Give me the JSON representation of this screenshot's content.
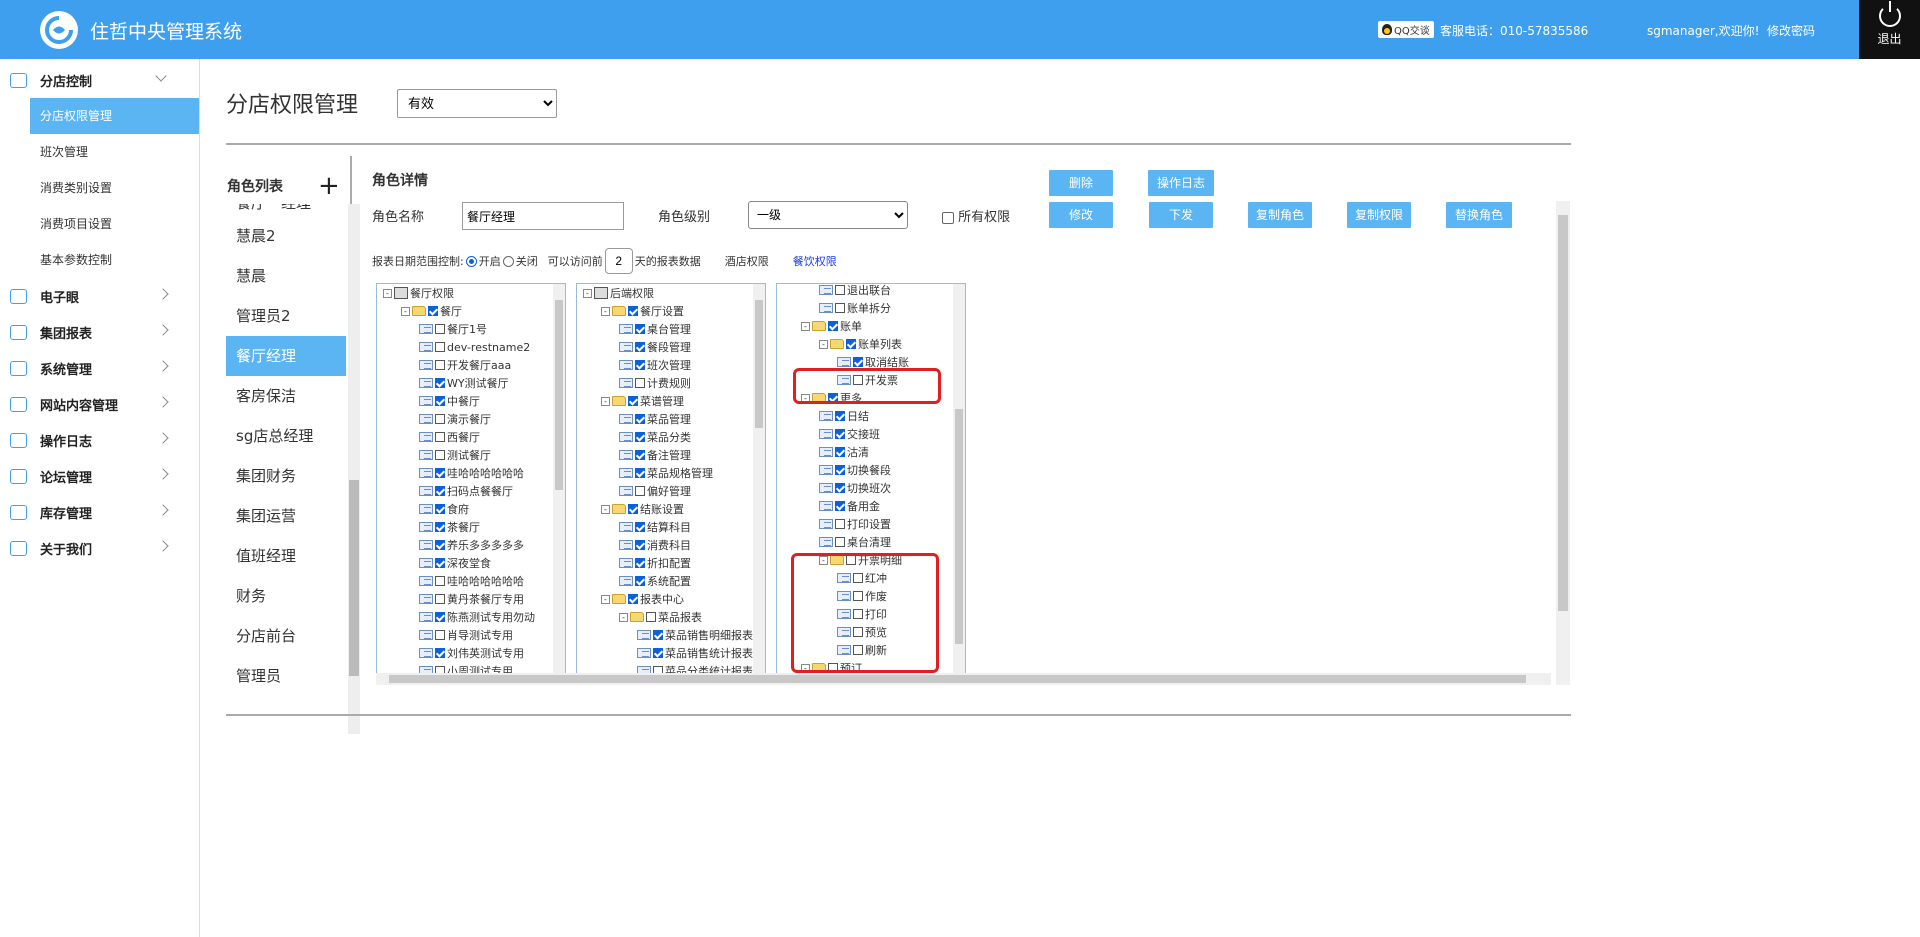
{
  "header": {
    "title": "住哲中央管理系统",
    "qq_label": "QQ交谈",
    "hotline": "客服电话：010-57835586",
    "welcome": "sgmanager,欢迎你!",
    "change_password": "修改密码",
    "logout": "退出"
  },
  "sidebar": {
    "groups": [
      {
        "label": "分店控制",
        "icon": "store-icon"
      },
      {
        "label": "电子眼",
        "icon": "camera-icon"
      },
      {
        "label": "集团报表",
        "icon": "chart-icon"
      },
      {
        "label": "系统管理",
        "icon": "settings-icon"
      },
      {
        "label": "网站内容管理",
        "icon": "grid-icon"
      },
      {
        "label": "操作日志",
        "icon": "log-icon"
      },
      {
        "label": "论坛管理",
        "icon": "atom-icon"
      },
      {
        "label": "库存管理",
        "icon": "inventory-icon"
      },
      {
        "label": "关于我们",
        "icon": "user-icon"
      }
    ],
    "sub_items": [
      "分店权限管理",
      "班次管理",
      "消费类别设置",
      "消费项目设置",
      "基本参数控制"
    ]
  },
  "main": {
    "page_title": "分店权限管理",
    "status_value": "有效",
    "role_list_header": "角色列表",
    "role_partial": "餐厅一经理",
    "roles": [
      "慧晨2",
      "慧晨",
      "管理员2",
      "餐厅经理",
      "客房保洁",
      "sg店总经理",
      "集团财务",
      "集团运营",
      "值班经理",
      "财务",
      "分店前台",
      "管理员"
    ],
    "detail_header": "角色详情",
    "buttons": {
      "delete": "删除",
      "op_log": "操作日志",
      "modify": "修改",
      "dispatch": "下发",
      "copy_role": "复制角色",
      "copy_perm": "复制权限",
      "replace_role": "替换角色"
    },
    "role_name_label": "角色名称",
    "role_name_value": "餐厅经理",
    "role_level_label": "角色级别",
    "role_level_value": "一级",
    "all_perm_label": "所有权限",
    "report_ctrl_label": "报表日期范围控制:",
    "open_label": "开启",
    "close_label": "关闭",
    "access_prefix": "可以访问前",
    "access_days": "2",
    "access_suffix": "天的报表数据",
    "hotel_perm": "酒店权限",
    "dining_perm": "餐饮权限"
  },
  "tree1": [
    {
      "t": "餐厅权限",
      "lvl": 0,
      "kind": "root",
      "cb": null
    },
    {
      "t": "餐厅",
      "lvl": 1,
      "kind": "folder",
      "cb": true
    },
    {
      "t": "餐厅1号",
      "lvl": 2,
      "kind": "leaf",
      "cb": false
    },
    {
      "t": "dev-restname2",
      "lvl": 2,
      "kind": "leaf",
      "cb": false
    },
    {
      "t": "开发餐厅aaa",
      "lvl": 2,
      "kind": "leaf",
      "cb": false
    },
    {
      "t": "WY测试餐厅",
      "lvl": 2,
      "kind": "leaf",
      "cb": true
    },
    {
      "t": "中餐厅",
      "lvl": 2,
      "kind": "leaf",
      "cb": true
    },
    {
      "t": "演示餐厅",
      "lvl": 2,
      "kind": "leaf",
      "cb": false
    },
    {
      "t": "西餐厅",
      "lvl": 2,
      "kind": "leaf",
      "cb": false
    },
    {
      "t": "测试餐厅",
      "lvl": 2,
      "kind": "leaf",
      "cb": false
    },
    {
      "t": "哇哈哈哈哈哈哈",
      "lvl": 2,
      "kind": "leaf",
      "cb": true
    },
    {
      "t": "扫码点餐餐厅",
      "lvl": 2,
      "kind": "leaf",
      "cb": true
    },
    {
      "t": "食府",
      "lvl": 2,
      "kind": "leaf",
      "cb": true
    },
    {
      "t": "茶餐厅",
      "lvl": 2,
      "kind": "leaf",
      "cb": true
    },
    {
      "t": "养乐多多多多多",
      "lvl": 2,
      "kind": "leaf",
      "cb": true
    },
    {
      "t": "深夜堂食",
      "lvl": 2,
      "kind": "leaf",
      "cb": true
    },
    {
      "t": "哇哈哈哈哈哈哈",
      "lvl": 2,
      "kind": "leaf",
      "cb": false
    },
    {
      "t": "黄丹茶餐厅专用",
      "lvl": 2,
      "kind": "leaf",
      "cb": false
    },
    {
      "t": "陈燕测试专用勿动",
      "lvl": 2,
      "kind": "leaf",
      "cb": true
    },
    {
      "t": "肖导测试专用",
      "lvl": 2,
      "kind": "leaf",
      "cb": false
    },
    {
      "t": "刘伟英测试专用",
      "lvl": 2,
      "kind": "leaf",
      "cb": true
    },
    {
      "t": "小周测试专用",
      "lvl": 2,
      "kind": "leaf",
      "cb": false
    }
  ],
  "tree2": [
    {
      "t": "后端权限",
      "lvl": 0,
      "kind": "root",
      "cb": null
    },
    {
      "t": "餐厅设置",
      "lvl": 1,
      "kind": "folder",
      "cb": true
    },
    {
      "t": "桌台管理",
      "lvl": 2,
      "kind": "leaf",
      "cb": true
    },
    {
      "t": "餐段管理",
      "lvl": 2,
      "kind": "leaf",
      "cb": true
    },
    {
      "t": "班次管理",
      "lvl": 2,
      "kind": "leaf",
      "cb": true
    },
    {
      "t": "计费规则",
      "lvl": 2,
      "kind": "leaf",
      "cb": false
    },
    {
      "t": "菜谱管理",
      "lvl": 1,
      "kind": "folder",
      "cb": true
    },
    {
      "t": "菜品管理",
      "lvl": 2,
      "kind": "leaf",
      "cb": true
    },
    {
      "t": "菜品分类",
      "lvl": 2,
      "kind": "leaf",
      "cb": true
    },
    {
      "t": "备注管理",
      "lvl": 2,
      "kind": "leaf",
      "cb": true
    },
    {
      "t": "菜品规格管理",
      "lvl": 2,
      "kind": "leaf",
      "cb": true
    },
    {
      "t": "偏好管理",
      "lvl": 2,
      "kind": "leaf",
      "cb": false
    },
    {
      "t": "结账设置",
      "lvl": 1,
      "kind": "folder",
      "cb": true
    },
    {
      "t": "结算科目",
      "lvl": 2,
      "kind": "leaf",
      "cb": true
    },
    {
      "t": "消费科目",
      "lvl": 2,
      "kind": "leaf",
      "cb": true
    },
    {
      "t": "折扣配置",
      "lvl": 2,
      "kind": "leaf",
      "cb": true
    },
    {
      "t": "系统配置",
      "lvl": 2,
      "kind": "leaf",
      "cb": true
    },
    {
      "t": "报表中心",
      "lvl": 1,
      "kind": "folder",
      "cb": true
    },
    {
      "t": "菜品报表",
      "lvl": 2,
      "kind": "folder",
      "cb": false
    },
    {
      "t": "菜品销售明细报表",
      "lvl": 3,
      "kind": "leaf",
      "cb": true
    },
    {
      "t": "菜品销售统计报表",
      "lvl": 3,
      "kind": "leaf",
      "cb": true
    },
    {
      "t": "菜品分类统计报表",
      "lvl": 3,
      "kind": "leaf",
      "cb": false
    }
  ],
  "tree3": [
    {
      "t": "退出联台",
      "lvl": 2,
      "kind": "leaf",
      "cb": false
    },
    {
      "t": "账单拆分",
      "lvl": 2,
      "kind": "leaf",
      "cb": false
    },
    {
      "t": "账单",
      "lvl": 1,
      "kind": "folder",
      "cb": true
    },
    {
      "t": "账单列表",
      "lvl": 2,
      "kind": "folder",
      "cb": true
    },
    {
      "t": "取消结账",
      "lvl": 3,
      "kind": "leaf",
      "cb": true
    },
    {
      "t": "开发票",
      "lvl": 3,
      "kind": "leaf",
      "cb": false
    },
    {
      "t": "更多",
      "lvl": 1,
      "kind": "folder",
      "cb": true
    },
    {
      "t": "日结",
      "lvl": 2,
      "kind": "leaf",
      "cb": true
    },
    {
      "t": "交接班",
      "lvl": 2,
      "kind": "leaf",
      "cb": true
    },
    {
      "t": "沽清",
      "lvl": 2,
      "kind": "leaf",
      "cb": true
    },
    {
      "t": "切换餐段",
      "lvl": 2,
      "kind": "leaf",
      "cb": true
    },
    {
      "t": "切换班次",
      "lvl": 2,
      "kind": "leaf",
      "cb": true
    },
    {
      "t": "备用金",
      "lvl": 2,
      "kind": "leaf",
      "cb": true
    },
    {
      "t": "打印设置",
      "lvl": 2,
      "kind": "leaf",
      "cb": false
    },
    {
      "t": "桌台清理",
      "lvl": 2,
      "kind": "leaf",
      "cb": false
    },
    {
      "t": "开票明细",
      "lvl": 2,
      "kind": "folder",
      "cb": false
    },
    {
      "t": "红冲",
      "lvl": 3,
      "kind": "leaf",
      "cb": false
    },
    {
      "t": "作废",
      "lvl": 3,
      "kind": "leaf",
      "cb": false
    },
    {
      "t": "打印",
      "lvl": 3,
      "kind": "leaf",
      "cb": false
    },
    {
      "t": "预览",
      "lvl": 3,
      "kind": "leaf",
      "cb": false
    },
    {
      "t": "刷新",
      "lvl": 3,
      "kind": "leaf",
      "cb": false
    },
    {
      "t": "预订",
      "lvl": 1,
      "kind": "folder",
      "cb": false
    }
  ],
  "colors": {
    "header_bg": "#3d9fee",
    "accent": "#5bb5f2",
    "highlight": "#e02020"
  }
}
